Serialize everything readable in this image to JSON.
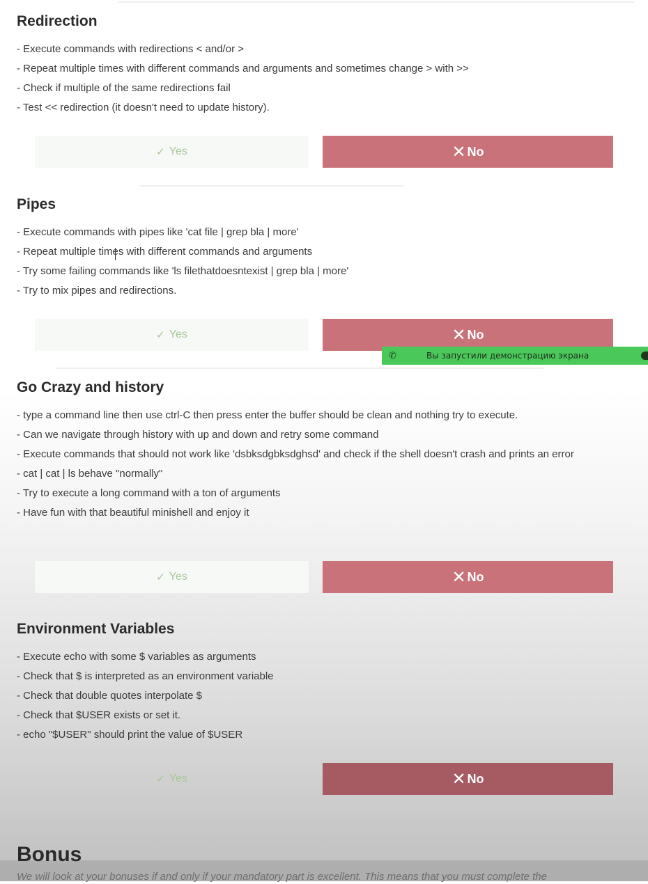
{
  "sections": [
    {
      "title": "Redirection",
      "lines": [
        "- Execute commands with redirections < and/or >",
        "- Repeat multiple times with different commands and arguments and sometimes change > with >>",
        "- Check if multiple of the same redirections fail",
        "- Test << redirection (it doesn't need to update history)."
      ],
      "yes_label": "Yes",
      "no_label": "No"
    },
    {
      "title": "Pipes",
      "lines": [
        "- Execute commands with pipes like 'cat file | grep bla | more'",
        "- Repeat multiple times with different commands and arguments",
        "- Try some failing commands like 'ls filethatdoesntexist | grep bla | more'",
        "- Try to mix pipes and redirections."
      ],
      "yes_label": "Yes",
      "no_label": "No"
    },
    {
      "title": "Go Crazy and history",
      "lines": [
        "- type a command line then use ctrl-C then press enter the buffer should be clean and nothing try to execute.",
        "- Can we navigate through history with up and down and retry some command",
        "- Execute commands that should not work like 'dsbksdgbksdghsd' and check if the shell doesn't crash and prints an error",
        "- cat | cat | ls behave \"normally\"",
        "- Try to execute a long command with a ton of arguments",
        "- Have fun with that beautiful minishell and enjoy it"
      ],
      "yes_label": "Yes",
      "no_label": "No"
    },
    {
      "title": "Environment Variables",
      "lines": [
        "- Execute echo with some $ variables as arguments",
        "- Check that $ is interpreted as an environment variable",
        "- Check that double quotes interpolate $",
        "- Check that $USER exists or set it.",
        "- echo \"$USER\" should print the value of $USER"
      ],
      "yes_label": "Yes",
      "no_label": "No"
    }
  ],
  "share_banner": {
    "text": "Вы запустили демонстрацию экрана",
    "icon": "phone-icon"
  },
  "bonus": {
    "title": "Bonus",
    "text": "We will look at your bonuses if and only if your mandatory part is excellent. This means that you must complete the"
  },
  "icons": {
    "yes": "check-circle-icon",
    "no": "x-icon"
  },
  "colors": {
    "no_button": "#c9727a",
    "yes_button_bg": "#f7f9f6",
    "yes_text": "#a7c79a",
    "share_banner": "#4bc85a"
  }
}
